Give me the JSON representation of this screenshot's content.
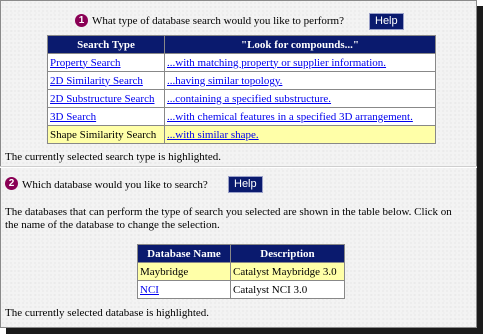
{
  "section1": {
    "number": "1",
    "question": "What type of database search would you like to perform?",
    "help_label": "Help",
    "table": {
      "headers": [
        "Search Type",
        "\"Look for compounds...\""
      ],
      "rows": [
        {
          "type": "Property Search",
          "desc": "...with matching property or supplier information."
        },
        {
          "type": "2D Similarity Search",
          "desc": "...having similar topology."
        },
        {
          "type": "2D Substructure Search",
          "desc": "...containing a specified substructure."
        },
        {
          "type": "3D Search",
          "desc": "...with chemical features in a specified 3D arrangement."
        },
        {
          "type": "Shape Similarity Search",
          "desc": "...with similar shape."
        }
      ]
    },
    "note": "The currently selected search type is highlighted."
  },
  "section2": {
    "number": "2",
    "question": "Which database would you like to search?",
    "help_label": "Help",
    "intro": "The databases that can perform the type of search you selected are shown in the table below. Click on the name of the database to change the selection.",
    "table": {
      "headers": [
        "Database Name",
        "Description"
      ],
      "rows": [
        {
          "name": "Maybridge",
          "desc": "Catalyst Maybridge 3.0"
        },
        {
          "name": "NCI",
          "desc": "Catalyst NCI 3.0"
        }
      ]
    },
    "note": "The currently selected database is highlighted."
  },
  "colors": {
    "header_bg": "#0a1a6e",
    "highlight": "#ffffa8",
    "link": "#0000ee",
    "step_icon": "#8a0055"
  }
}
